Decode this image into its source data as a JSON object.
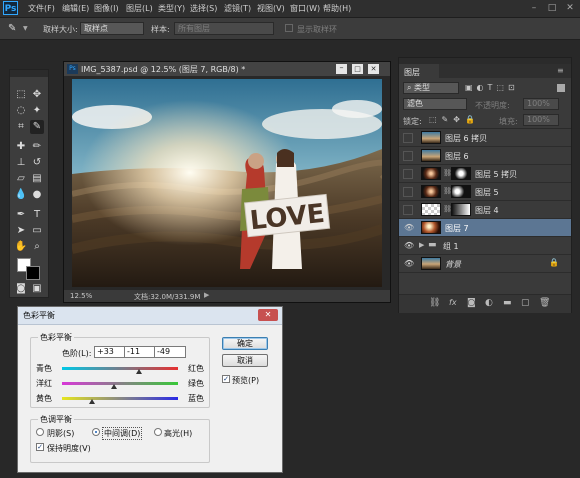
{
  "menubar": {
    "logo": "Ps",
    "items": [
      "文件(F)",
      "编辑(E)",
      "图像(I)",
      "图层(L)",
      "类型(Y)",
      "选择(S)",
      "滤镜(T)",
      "视图(V)",
      "窗口(W)",
      "帮助(H)"
    ]
  },
  "options": {
    "sample_size_label": "取样大小:",
    "sample_size_value": "取样点",
    "sample_label": "样本:",
    "sample_value": "所有图层",
    "show_ring_label": "显示取样环"
  },
  "document": {
    "tab_icon": "Ps",
    "title": "IMG_5387.psd @ 12.5% (图层 7, RGB/8) *",
    "zoom": "12.5%",
    "doc_size": "文档:32.0M/331.9M",
    "sign_text": "LOVE"
  },
  "layers": {
    "panel_title": "图层",
    "filter_kind": "类型",
    "blend_mode": "滤色",
    "opacity_label": "不透明度:",
    "opacity_value": "100%",
    "lock_label": "锁定:",
    "fill_label": "填充:",
    "fill_value": "100%",
    "rows": [
      {
        "name": "图层 6 拷贝",
        "visible": false
      },
      {
        "name": "图层 6",
        "visible": false
      },
      {
        "name": "图层 5 拷贝",
        "visible": false
      },
      {
        "name": "图层 5",
        "visible": false
      },
      {
        "name": "图层 4",
        "visible": false
      },
      {
        "name": "图层 7",
        "visible": true,
        "selected": true
      },
      {
        "name": "组 1",
        "visible": true
      },
      {
        "name": "背景",
        "visible": true
      }
    ]
  },
  "dialog": {
    "title": "色彩平衡",
    "color_balance_group": "色彩平衡",
    "levels_label": "色阶(L):",
    "levels": [
      "+33",
      "-11",
      "-49"
    ],
    "sliders": [
      {
        "left": "青色",
        "right": "红色",
        "value": 33
      },
      {
        "left": "洋红",
        "right": "绿色",
        "value": -11
      },
      {
        "left": "黄色",
        "right": "蓝色",
        "value": -49
      }
    ],
    "ok": "确定",
    "cancel": "取消",
    "preview": "预览(P)",
    "tone_group": "色调平衡",
    "shadows": "阴影(S)",
    "midtones": "中间调(D)",
    "highlights": "高光(H)",
    "preserve": "保持明度(V)"
  }
}
